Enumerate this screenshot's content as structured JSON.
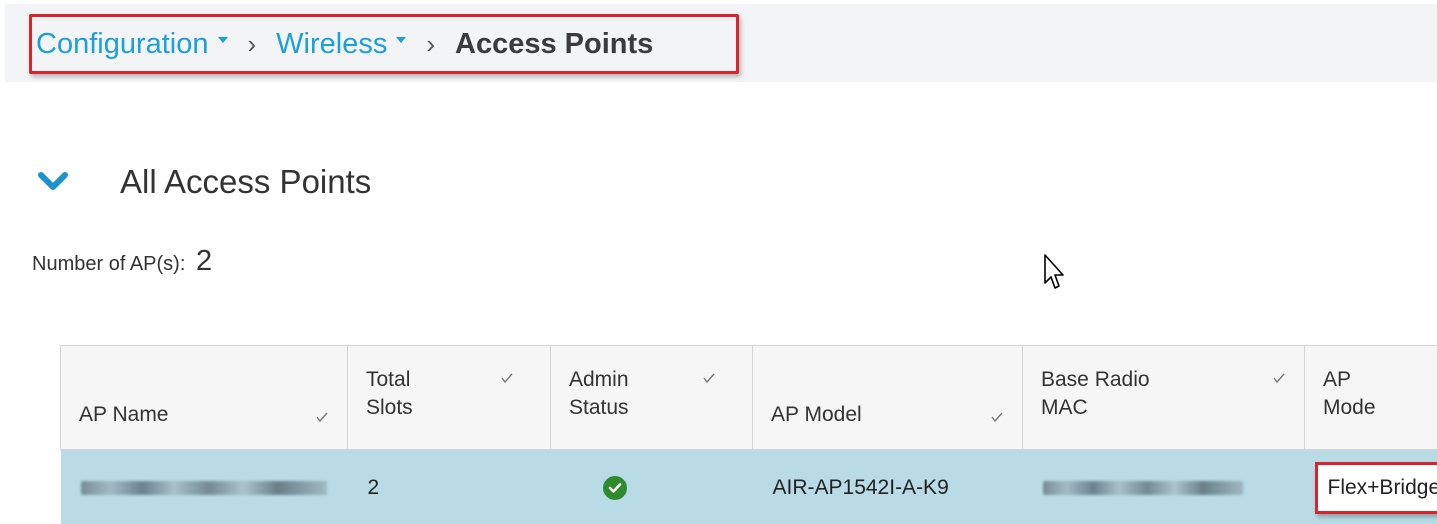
{
  "breadcrumb": {
    "items": [
      {
        "label": "Configuration",
        "dropdown": true
      },
      {
        "label": "Wireless",
        "dropdown": true
      }
    ],
    "separator": "›",
    "current": "Access Points"
  },
  "section": {
    "title": "All Access Points",
    "expanded": true
  },
  "ap_count": {
    "label": "Number of AP(s):",
    "value": "2"
  },
  "table": {
    "columns": [
      {
        "line1": "",
        "line2": "AP Name"
      },
      {
        "line1": "Total",
        "line2": "Slots"
      },
      {
        "line1": "Admin",
        "line2": "Status"
      },
      {
        "line1": "",
        "line2": "AP Model"
      },
      {
        "line1": "Base Radio",
        "line2": "MAC"
      },
      {
        "line1": "AP",
        "line2": "Mode"
      }
    ],
    "rows": [
      {
        "ap_name": "",
        "total_slots": "2",
        "admin_status": "enabled",
        "ap_model": "AIR-AP1542I-A-K9",
        "base_radio_mac": "",
        "ap_mode": "Flex+Bridge"
      }
    ]
  },
  "colors": {
    "link": "#1e9fd8",
    "highlight_border": "#d9232d",
    "row_selected": "#b9dbe5",
    "status_ok": "#2e8b2e"
  },
  "icons": [
    "caret-down-icon",
    "chevron-down-icon",
    "sort-icon",
    "check-circle-icon",
    "mouse-pointer-icon"
  ]
}
